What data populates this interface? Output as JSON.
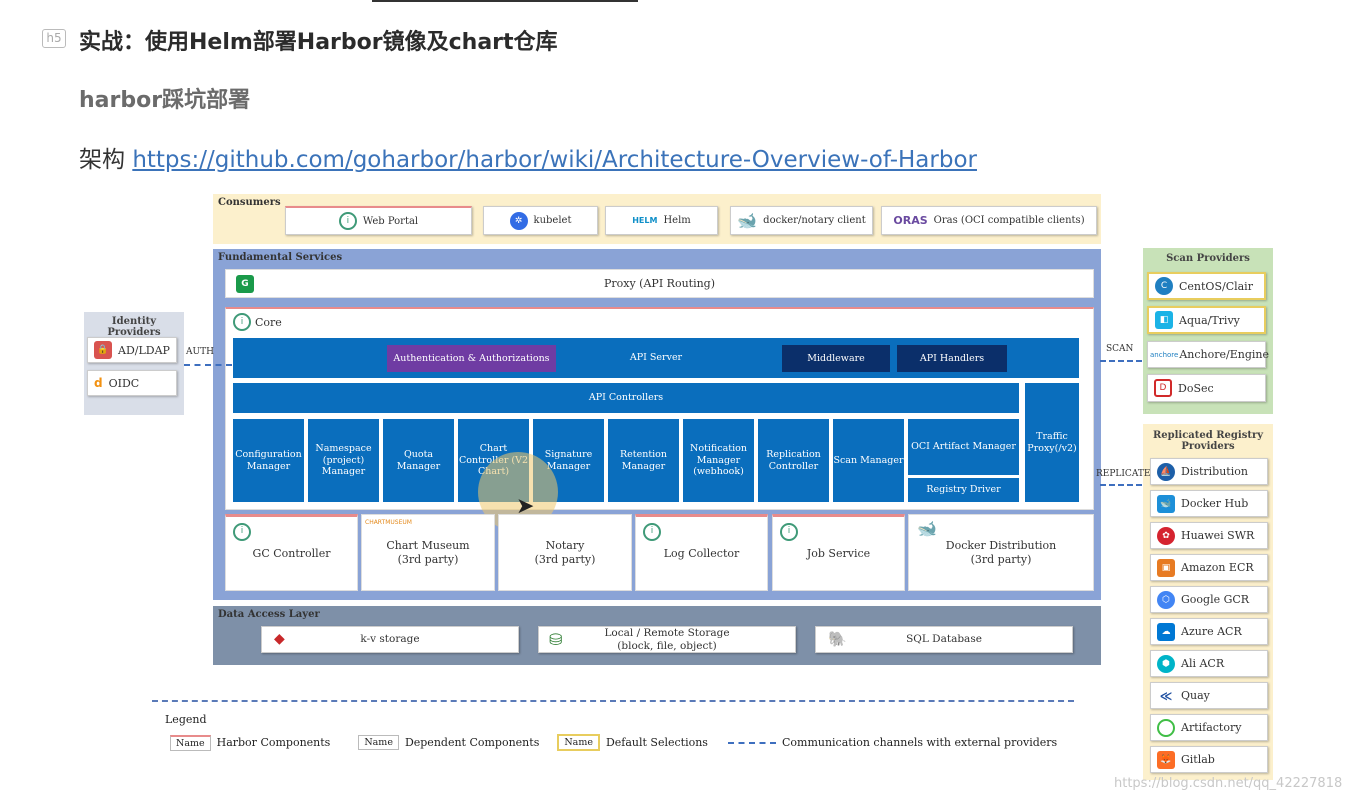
{
  "doc": {
    "badge": "h5",
    "heading": "实战：使用Helm部署Harbor镜像及chart仓库",
    "subheading": "harbor踩坑部署",
    "arch_prefix": "架构",
    "arch_link": "https://github.com/goharbor/harbor/wiki/Architecture-Overview-of-Harbor"
  },
  "diagram": {
    "consumers": {
      "title": "Consumers",
      "items": [
        "Web Portal",
        "kubelet",
        "Helm",
        "docker/notary client",
        "Oras (OCI compatible clients)"
      ]
    },
    "fundamental": {
      "title": "Fundamental Services",
      "proxy": "Proxy (API Routing)",
      "core": "Core",
      "auth": "Authentication & Authorizations",
      "api_server": "API Server",
      "middleware": "Middleware",
      "api_handlers": "API Handlers",
      "api_controllers": "API Controllers",
      "traffic_proxy": "Traffic Proxy(/v2)",
      "registry_driver": "Registry Driver",
      "managers": [
        "Configuration Manager",
        "Namespace (project) Manager",
        "Quota Manager",
        "Chart Controller (V2 Chart)",
        "Signature Manager",
        "Retention Manager",
        "Notification Manager (webhook)",
        "Replication Controller",
        "Scan Manager",
        "OCI Artifact Manager"
      ],
      "bottom": [
        {
          "name": "GC Controller",
          "sub": ""
        },
        {
          "name": "Chart Museum",
          "sub": "(3rd party)"
        },
        {
          "name": "Notary",
          "sub": "(3rd party)"
        },
        {
          "name": "Log Collector",
          "sub": ""
        },
        {
          "name": "Job Service",
          "sub": ""
        },
        {
          "name": "Docker Distribution",
          "sub": "(3rd party)"
        }
      ],
      "chartmuseum_logo": "CHARTMUSEUM"
    },
    "data_access": {
      "title": "Data Access Layer",
      "items": [
        {
          "name": "k-v storage",
          "sub": ""
        },
        {
          "name": "Local / Remote Storage",
          "sub": "(block, file, object)"
        },
        {
          "name": "SQL Database",
          "sub": ""
        }
      ]
    },
    "identity": {
      "title": "Identity Providers",
      "items": [
        "AD/LDAP",
        "OIDC"
      ],
      "arrow": "AUTH"
    },
    "scan": {
      "title": "Scan Providers",
      "items": [
        "CentOS/Clair",
        "Aqua/Trivy",
        "Anchore/Engine",
        "DoSec"
      ],
      "arrow": "SCAN",
      "anchore_prefix": "anchore"
    },
    "replicated": {
      "title": "Replicated Registry Providers",
      "items": [
        "Distribution",
        "Docker Hub",
        "Huawei SWR",
        "Amazon ECR",
        "Google GCR",
        "Azure ACR",
        "Ali ACR",
        "Quay",
        "Artifactory",
        "Gitlab"
      ],
      "arrow": "REPLICATE"
    },
    "legend": {
      "title": "Legend",
      "name_tag": "Name",
      "harbor": "Harbor Components",
      "dependent": "Dependent Components",
      "default": "Default Selections",
      "channel": "Communication channels with external providers"
    },
    "logos": {
      "helm": "HELM",
      "oras": "ORAS"
    }
  },
  "watermark": "https://blog.csdn.net/qq_42227818"
}
